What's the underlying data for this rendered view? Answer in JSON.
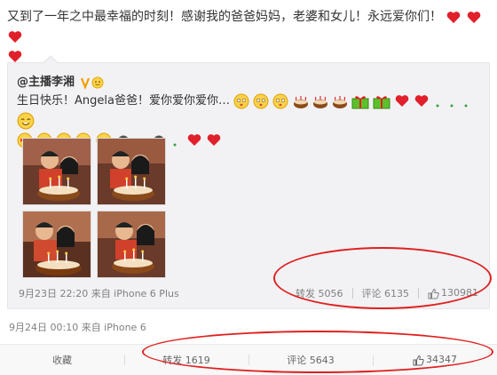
{
  "post": {
    "text": "又到了一年之中最幸福的时刻！感谢我的爸爸妈妈，老婆和女儿！永远爱你们！"
  },
  "original": {
    "author": "@主播李湘",
    "text": "生日快乐！Angela爸爸！爱你爱你爱你…",
    "meta": "9月23日 22:20 来自 iPhone 6 Plus",
    "repost_label": "转发 5056",
    "comment_label": "评论 6135",
    "like_count": "130981"
  },
  "post_meta": "9月24日 00:10 来自 iPhone 6",
  "actions": {
    "favorite": "收藏",
    "repost": "转发 1619",
    "comment": "评论 5643",
    "like": "34347"
  },
  "icons": [
    "heart-icon",
    "smiley-icon",
    "cake-icon",
    "gift-icon",
    "verified-badge-icon",
    "thumbs-up-icon"
  ],
  "colors": {
    "heart": "#e0202a",
    "highlight": "#e02020",
    "meta": "#808080"
  }
}
